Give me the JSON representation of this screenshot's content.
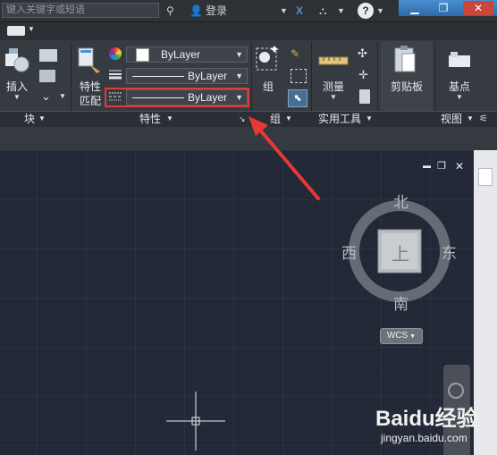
{
  "title_bar": {
    "search_placeholder": "键入关键字或短语",
    "login_label": "登录",
    "help_icon": "question-icon"
  },
  "ribbon": {
    "block_panel": {
      "insert_label": "插入",
      "title": "块"
    },
    "properties_panel": {
      "match_label_line1": "特性",
      "match_label_line2": "匹配",
      "color_value": "ByLayer",
      "lineweight_value": "ByLayer",
      "linetype_value": "ByLayer",
      "title": "特性"
    },
    "group_panel": {
      "group_label": "组",
      "title": "组"
    },
    "utilities_panel": {
      "measure_label": "测量",
      "title": "实用工具"
    },
    "clipboard_panel": {
      "clipboard_label": "剪贴板"
    },
    "view_panel": {
      "base_label": "基点",
      "title": "视图"
    }
  },
  "viewcube": {
    "north": "北",
    "south": "南",
    "east": "东",
    "west": "西",
    "top": "上",
    "wcs_label": "WCS"
  },
  "watermark": {
    "brand": "Baidu经验",
    "url": "jingyan.baidu.com"
  },
  "colors": {
    "highlight_box": "#e53935",
    "annotation_arrow": "#e53935",
    "canvas_bg": "#222836",
    "ribbon_bg": "#363b42"
  }
}
